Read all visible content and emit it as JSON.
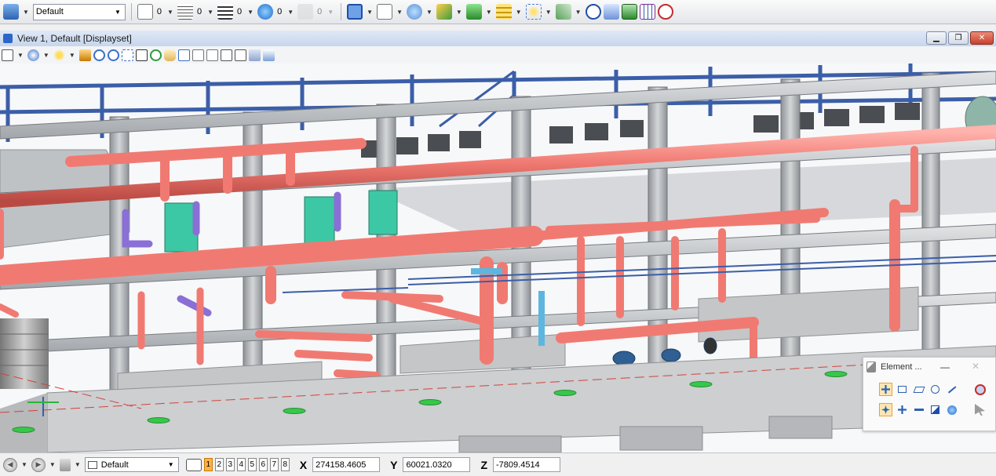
{
  "top_toolbar": {
    "level_combo": "Default",
    "counts": [
      "0",
      "0",
      "0",
      "0",
      "0"
    ]
  },
  "view": {
    "title": "View 1, Default [Displayset]"
  },
  "element_panel": {
    "title": "Element ...",
    "minimize": "—",
    "close": "✕"
  },
  "status_bar": {
    "model_combo": "Default",
    "view_numbers": [
      "1",
      "2",
      "3",
      "4",
      "5",
      "6",
      "7",
      "8"
    ],
    "active_view": "1",
    "x_label": "X",
    "x_value": "274158.4605",
    "y_label": "Y",
    "y_value": "60021.0320",
    "z_label": "Z",
    "z_value": "-7809.4514"
  },
  "colors": {
    "pipe_red": "#f07a72",
    "steel_blue": "#3b5ea8",
    "concrete": "#c4c6c8",
    "equipment_teal": "#3cc8a4",
    "active_orange": "#ffb243"
  }
}
